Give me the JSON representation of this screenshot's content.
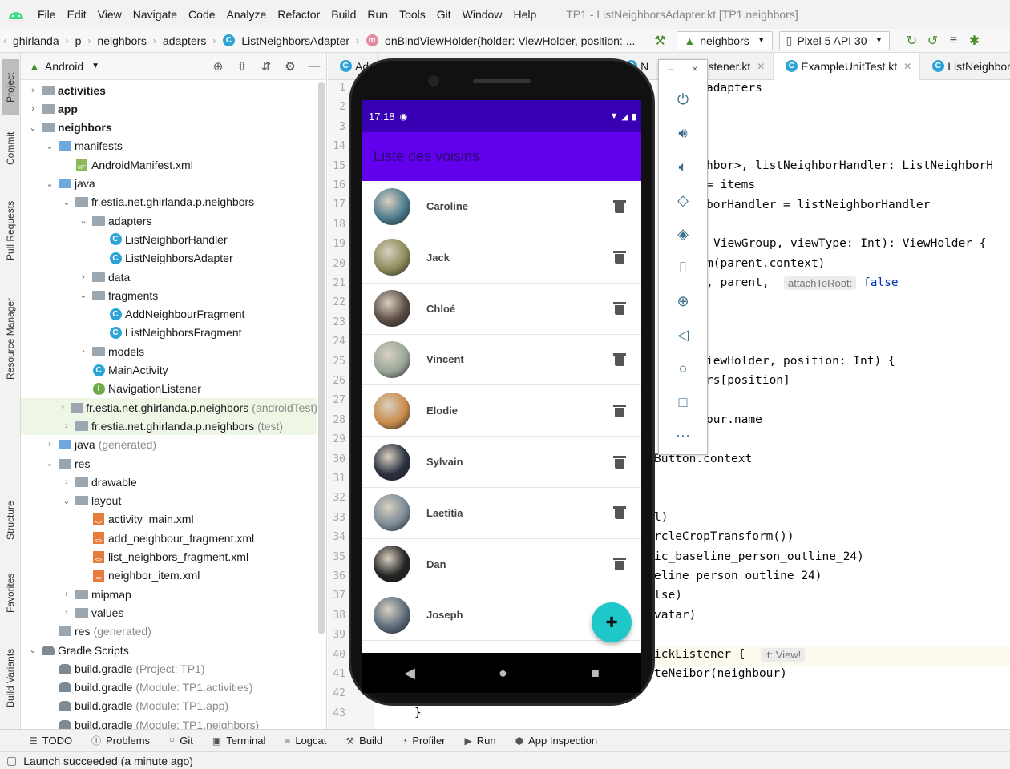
{
  "menu": {
    "items": [
      "File",
      "Edit",
      "View",
      "Navigate",
      "Code",
      "Analyze",
      "Refactor",
      "Build",
      "Run",
      "Tools",
      "Git",
      "Window",
      "Help"
    ],
    "window_title": "TP1 - ListNeighborsAdapter.kt [TP1.neighbors]"
  },
  "nav": {
    "crumbs": [
      "ghirlanda",
      "p",
      "neighbors",
      "adapters",
      "ListNeighborsAdapter",
      "onBindViewHolder(holder: ViewHolder, position: ..."
    ],
    "module_combo": "neighbors",
    "device_combo": "Pixel 5 API 30"
  },
  "left_strip": {
    "tabs": [
      "Project",
      "Commit",
      "Pull Requests",
      "Resource Manager",
      "Structure",
      "Favorites",
      "Build Variants"
    ]
  },
  "project": {
    "view_mode": "Android",
    "tree": [
      {
        "label": "activities",
        "bold": true,
        "suffix": ""
      },
      {
        "label": "app",
        "bold": true,
        "suffix": ""
      },
      {
        "label": "neighbors",
        "bold": true,
        "suffix": ""
      },
      {
        "label": "manifests",
        "suffix": ""
      },
      {
        "label": "AndroidManifest.xml",
        "suffix": ""
      },
      {
        "label": "java",
        "suffix": ""
      },
      {
        "label": "fr.estia.net.ghirlanda.p.neighbors",
        "suffix": ""
      },
      {
        "label": "adapters",
        "suffix": ""
      },
      {
        "label": "ListNeighborHandler",
        "suffix": ""
      },
      {
        "label": "ListNeighborsAdapter",
        "suffix": ""
      },
      {
        "label": "data",
        "suffix": ""
      },
      {
        "label": "fragments",
        "suffix": ""
      },
      {
        "label": "AddNeighbourFragment",
        "suffix": ""
      },
      {
        "label": "ListNeighborsFragment",
        "suffix": ""
      },
      {
        "label": "models",
        "suffix": ""
      },
      {
        "label": "MainActivity",
        "suffix": ""
      },
      {
        "label": "NavigationListener",
        "suffix": ""
      },
      {
        "label": "fr.estia.net.ghirlanda.p.neighbors",
        "suffix": "(androidTest)"
      },
      {
        "label": "fr.estia.net.ghirlanda.p.neighbors",
        "suffix": "(test)"
      },
      {
        "label": "java",
        "suffix": "(generated)"
      },
      {
        "label": "res",
        "suffix": ""
      },
      {
        "label": "drawable",
        "suffix": ""
      },
      {
        "label": "layout",
        "suffix": ""
      },
      {
        "label": "activity_main.xml",
        "suffix": ""
      },
      {
        "label": "add_neighbour_fragment.xml",
        "suffix": ""
      },
      {
        "label": "list_neighbors_fragment.xml",
        "suffix": ""
      },
      {
        "label": "neighbor_item.xml",
        "suffix": ""
      },
      {
        "label": "mipmap",
        "suffix": ""
      },
      {
        "label": "values",
        "suffix": ""
      },
      {
        "label": "res",
        "suffix": "(generated)"
      },
      {
        "label": "Gradle Scripts",
        "suffix": ""
      },
      {
        "label": "build.gradle",
        "suffix": "(Project: TP1)"
      },
      {
        "label": "build.gradle",
        "suffix": "(Module: TP1.activities)"
      },
      {
        "label": "build.gradle",
        "suffix": "(Module: TP1.app)"
      },
      {
        "label": "build.gradle",
        "suffix": "(Module: TP1.neighbors)"
      }
    ]
  },
  "editor": {
    "tabs": [
      {
        "label": "Ad"
      },
      {
        "label": "N"
      },
      {
        "label": "istener.kt"
      },
      {
        "label": "ExampleUnitTest.kt"
      },
      {
        "label": "ListNeighborH"
      }
    ],
    "line_numbers": [
      "1",
      "2",
      "3",
      "14",
      "15",
      "16",
      "17",
      "18",
      "19",
      "20",
      "21",
      "22",
      "23",
      "24",
      "25",
      "26",
      "27",
      "28",
      "29",
      "30",
      "31",
      "32",
      "33",
      "34",
      "35",
      "36",
      "37",
      "38",
      "39",
      "40",
      "41",
      "42",
      "43"
    ],
    "code_lines": [
      "adapters",
      "hbor>, listNeighborHandler: ListNeighborH",
      "= items",
      "borHandler = listNeighborHandler",
      "ViewGroup, viewType: Int): ViewHolder {",
      "m(parent.context)",
      ", parent,",
      "iewHolder, position: Int) {",
      "rs[position]",
      "our.name",
      "Button.context",
      "l)",
      "rcleCropTransform())",
      "ic_baseline_person_outline_24)",
      "eline_person_outline_24)",
      "lse)",
      "vatar)",
      "ickListener {",
      "teNeibor(neighbour)",
      "}"
    ],
    "hint_attach": "attachToRoot:",
    "hint_false": "false",
    "hint_it": "it: View!"
  },
  "emulator": {
    "title_min": "–",
    "title_close": "×"
  },
  "phone": {
    "time": "17:18",
    "app_title": "Liste des voisins",
    "neighbours": [
      {
        "name": "Caroline",
        "color": "#4a7a8c"
      },
      {
        "name": "Jack",
        "color": "#8a8a5a"
      },
      {
        "name": "Chloé",
        "color": "#5a4a42"
      },
      {
        "name": "Vincent",
        "color": "#9aa59a"
      },
      {
        "name": "Elodie",
        "color": "#c88a4a"
      },
      {
        "name": "Sylvain",
        "color": "#2a3040"
      },
      {
        "name": "Laetitia",
        "color": "#7a8a95"
      },
      {
        "name": "Dan",
        "color": "#222222"
      },
      {
        "name": "Joseph",
        "color": "#5a6a7a"
      }
    ],
    "status_color": "#3700b3",
    "appbar_color": "#6200ee",
    "fab_color": "#1ec8c8"
  },
  "bottom_tools": [
    "TODO",
    "Problems",
    "Git",
    "Terminal",
    "Logcat",
    "Build",
    "Profiler",
    "Run",
    "App Inspection"
  ],
  "status": "Launch succeeded (a minute ago)"
}
